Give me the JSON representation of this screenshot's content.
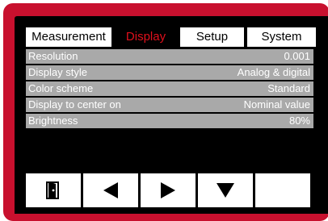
{
  "tabs": [
    {
      "label": "Measurement",
      "active": false
    },
    {
      "label": "Display",
      "active": true
    },
    {
      "label": "Setup",
      "active": false
    },
    {
      "label": "System",
      "active": false
    }
  ],
  "settings": [
    {
      "label": "Resolution",
      "value": "0.001"
    },
    {
      "label": "Display style",
      "value": "Analog & digital"
    },
    {
      "label": "Color scheme",
      "value": "Standard"
    },
    {
      "label": "Display to center on",
      "value": "Nominal value"
    },
    {
      "label": "Brightness",
      "value": "80%"
    }
  ],
  "toolbar": {
    "buttons": [
      {
        "icon": "exit-door-icon"
      },
      {
        "icon": "arrow-left-icon"
      },
      {
        "icon": "arrow-right-icon"
      },
      {
        "icon": "arrow-down-icon"
      },
      {
        "icon": "empty"
      }
    ]
  },
  "colors": {
    "bezel": "#c8102e",
    "screen": "#000000",
    "active_tab_text": "#e0101c",
    "row_background": "#a9a9a9",
    "row_text": "#ffffff"
  }
}
